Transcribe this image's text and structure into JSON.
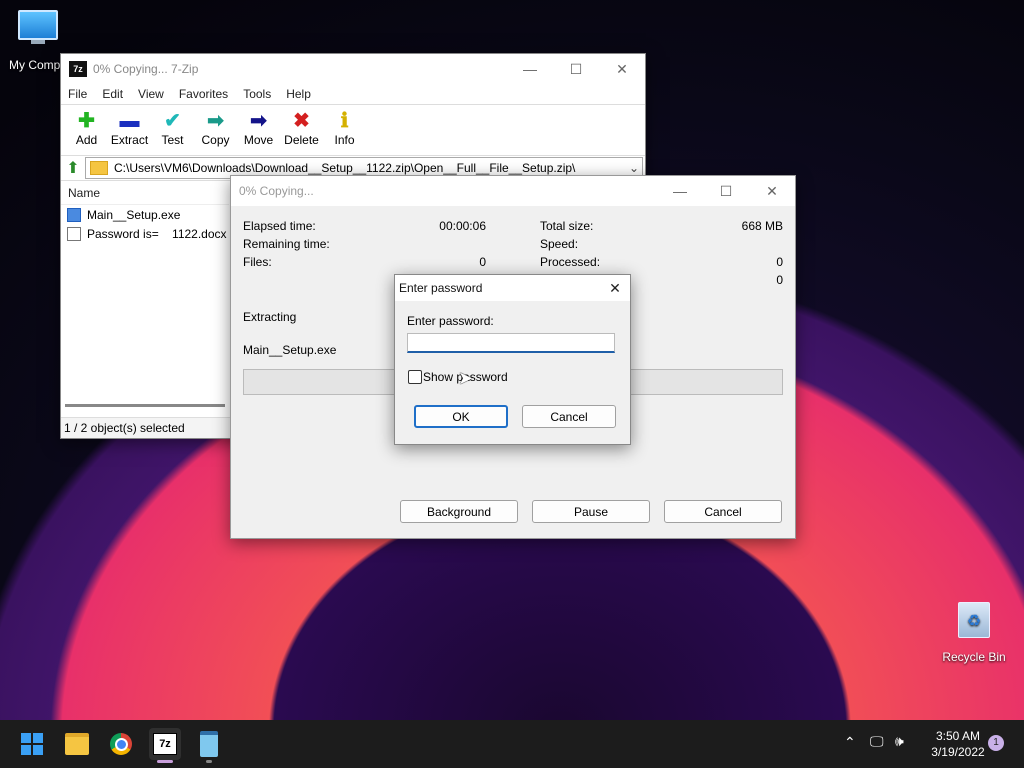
{
  "desktop": {
    "my_computer_label": "My Compu",
    "recycle_bin_label": "Recycle Bin"
  },
  "main_window": {
    "title": "0% Copying... 7-Zip",
    "app_icon_text": "7z",
    "menu": [
      "File",
      "Edit",
      "View",
      "Favorites",
      "Tools",
      "Help"
    ],
    "toolbar": [
      {
        "label": "Add",
        "icon": "add-icon"
      },
      {
        "label": "Extract",
        "icon": "extract-icon"
      },
      {
        "label": "Test",
        "icon": "test-icon"
      },
      {
        "label": "Copy",
        "icon": "copy-icon"
      },
      {
        "label": "Move",
        "icon": "move-icon"
      },
      {
        "label": "Delete",
        "icon": "delete-icon"
      },
      {
        "label": "Info",
        "icon": "info-icon"
      }
    ],
    "address": "C:\\Users\\VM6\\Downloads\\Download__Setup__1122.zip\\Open__Full__File__Setup.zip\\",
    "column_name": "Name",
    "files": [
      {
        "name": "Main__Setup.exe",
        "icon": "exe-icon"
      },
      {
        "name": "Password is=    1122.docx",
        "icon": "document-icon"
      }
    ],
    "status": "1 / 2 object(s) selected"
  },
  "copy_dialog": {
    "title": "0% Copying...",
    "elapsed_label": "Elapsed time:",
    "elapsed_value": "00:00:06",
    "remaining_label": "Remaining time:",
    "files_label": "Files:",
    "files_value": "0",
    "total_size_label": "Total size:",
    "total_size_value": "668 MB",
    "speed_label": "Speed:",
    "processed_label": "Processed:",
    "processed_value": "0",
    "extra_value": "0",
    "extracting_label": "Extracting",
    "current_file": "Main__Setup.exe",
    "progress_fraction": 0,
    "background_button": "Background",
    "pause_button": "Pause",
    "cancel_button": "Cancel"
  },
  "password_dialog": {
    "title": "Enter password",
    "prompt": "Enter password:",
    "password_value": "",
    "show_password_label": "Show password",
    "show_password_checked": false,
    "ok_button": "OK",
    "cancel_button": "Cancel"
  },
  "taskbar": {
    "apps": [
      "start-icon",
      "file-explorer-icon",
      "chrome-icon",
      "7zip-icon",
      "notepad-icon"
    ],
    "sevenzip_text": "7z",
    "time": "3:50 AM",
    "date": "3/19/2022",
    "notification_count": "1"
  }
}
